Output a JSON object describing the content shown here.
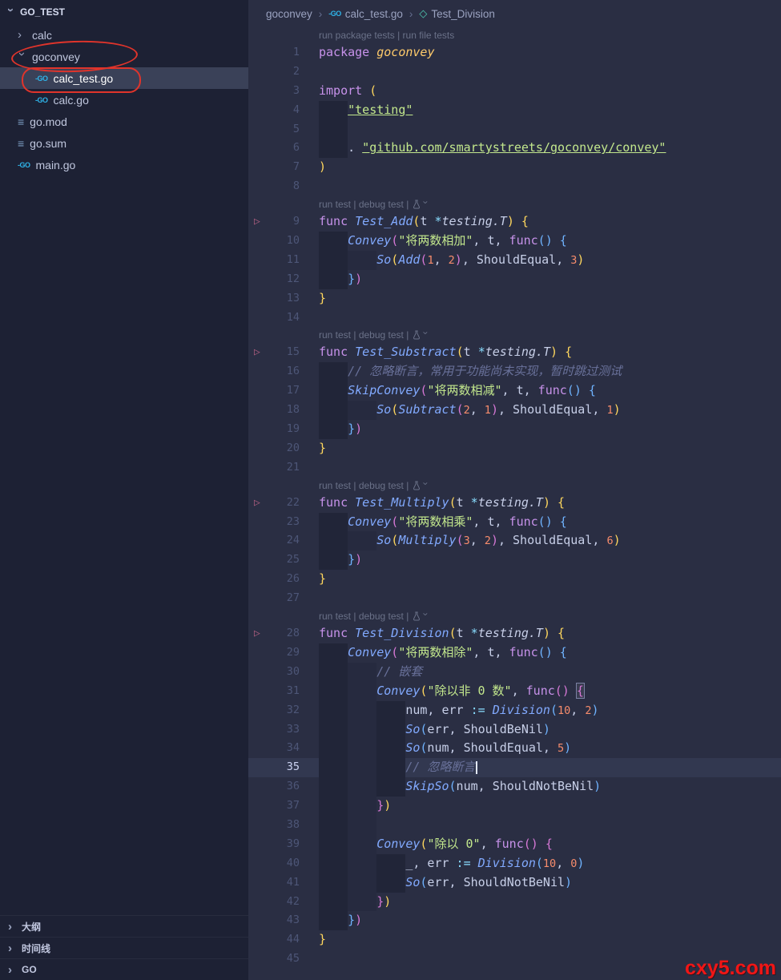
{
  "colors": {
    "annotation_red": "#e0342b",
    "watermark_red": "#f01616"
  },
  "glyphs": {
    "chevron": "›",
    "run": "▷",
    "go_file": "-GO",
    "module_file": "≡",
    "symbol": "◇"
  },
  "watermark": "cxy5.com",
  "sidebar": {
    "root": "GO_TEST",
    "items": [
      {
        "label": "calc",
        "kind": "folder",
        "state": "collapsed",
        "indent": 1
      },
      {
        "label": "goconvey",
        "kind": "folder",
        "state": "expanded",
        "indent": 1,
        "annotated": true
      },
      {
        "label": "calc_test.go",
        "kind": "file",
        "icon": "go",
        "indent": 2,
        "selected": true,
        "annotated": true
      },
      {
        "label": "calc.go",
        "kind": "file",
        "icon": "go",
        "indent": 2
      },
      {
        "label": "go.mod",
        "kind": "file",
        "icon": "mod",
        "indent": 1
      },
      {
        "label": "go.sum",
        "kind": "file",
        "icon": "mod",
        "indent": 1
      },
      {
        "label": "main.go",
        "kind": "file",
        "icon": "go",
        "indent": 1
      }
    ],
    "panels": [
      "大纲",
      "时间线",
      "GO"
    ]
  },
  "breadcrumb": {
    "separator": "›",
    "items": [
      {
        "label": "goconvey"
      },
      {
        "label": "calc_test.go",
        "icon": "go"
      },
      {
        "label": "Test_Division",
        "icon": "symbol-method"
      }
    ]
  },
  "codelens": {
    "top": {
      "links": [
        "run package tests",
        "run file tests"
      ],
      "separator": " | ",
      "has_icon": false
    },
    "test": {
      "links": [
        "run test",
        "debug test"
      ],
      "separator": " | ",
      "has_icon": true
    }
  },
  "editor": {
    "rows": [
      {
        "lens": "top"
      },
      {
        "n": 1,
        "ind": 0,
        "tok": [
          [
            "kw",
            "package "
          ],
          [
            "pkg",
            "goconvey"
          ]
        ]
      },
      {
        "n": 2,
        "ind": 0,
        "tok": []
      },
      {
        "n": 3,
        "ind": 0,
        "tok": [
          [
            "kw",
            "import "
          ],
          [
            "b1",
            "("
          ]
        ]
      },
      {
        "n": 4,
        "ind": 1,
        "tok": [
          [
            "lnk",
            "\"testing\""
          ]
        ]
      },
      {
        "n": 5,
        "ind": 1,
        "tok": []
      },
      {
        "n": 6,
        "ind": 1,
        "tok": [
          [
            "pln",
            ". "
          ],
          [
            "lnk",
            "\"github.com/smartystreets/goconvey/convey\""
          ]
        ]
      },
      {
        "n": 7,
        "ind": 0,
        "tok": [
          [
            "b1",
            ")"
          ]
        ]
      },
      {
        "n": 8,
        "ind": 0,
        "tok": []
      },
      {
        "lens": "test"
      },
      {
        "n": 9,
        "run": true,
        "ind": 0,
        "tok": [
          [
            "kw",
            "func "
          ],
          [
            "fn",
            "Test_Add"
          ],
          [
            "b1",
            "("
          ],
          [
            "pln",
            "t "
          ],
          [
            "op",
            "*"
          ],
          [
            "typ",
            "testing.T"
          ],
          [
            "b1",
            ")"
          ],
          [
            "pln",
            " "
          ],
          [
            "b1",
            "{"
          ]
        ]
      },
      {
        "n": 10,
        "ind": 1,
        "tok": [
          [
            "fn",
            "Convey"
          ],
          [
            "b2",
            "("
          ],
          [
            "str",
            "\"将两数相加\""
          ],
          [
            "pln",
            ", t, "
          ],
          [
            "kw",
            "func"
          ],
          [
            "b3",
            "()"
          ],
          [
            "pln",
            " "
          ],
          [
            "b3",
            "{"
          ]
        ]
      },
      {
        "n": 11,
        "ind": 2,
        "tok": [
          [
            "fn",
            "So"
          ],
          [
            "b1",
            "("
          ],
          [
            "fn",
            "Add"
          ],
          [
            "b2",
            "("
          ],
          [
            "num",
            "1"
          ],
          [
            "pln",
            ", "
          ],
          [
            "num",
            "2"
          ],
          [
            "b2",
            ")"
          ],
          [
            "pln",
            ", ShouldEqual, "
          ],
          [
            "num",
            "3"
          ],
          [
            "b1",
            ")"
          ]
        ]
      },
      {
        "n": 12,
        "ind": 1,
        "tok": [
          [
            "b3",
            "}"
          ],
          [
            "b2",
            ")"
          ]
        ]
      },
      {
        "n": 13,
        "ind": 0,
        "tok": [
          [
            "b1",
            "}"
          ]
        ]
      },
      {
        "n": 14,
        "ind": 0,
        "tok": []
      },
      {
        "lens": "test"
      },
      {
        "n": 15,
        "run": true,
        "ind": 0,
        "tok": [
          [
            "kw",
            "func "
          ],
          [
            "fn",
            "Test_Substract"
          ],
          [
            "b1",
            "("
          ],
          [
            "pln",
            "t "
          ],
          [
            "op",
            "*"
          ],
          [
            "typ",
            "testing.T"
          ],
          [
            "b1",
            ")"
          ],
          [
            "pln",
            " "
          ],
          [
            "b1",
            "{"
          ]
        ]
      },
      {
        "n": 16,
        "ind": 1,
        "tok": [
          [
            "cmt",
            "// 忽略断言，常用于功能尚未实现，暂时跳过测试"
          ]
        ]
      },
      {
        "n": 17,
        "ind": 1,
        "tok": [
          [
            "fn",
            "SkipConvey"
          ],
          [
            "b2",
            "("
          ],
          [
            "str",
            "\"将两数相减\""
          ],
          [
            "pln",
            ", t, "
          ],
          [
            "kw",
            "func"
          ],
          [
            "b3",
            "()"
          ],
          [
            "pln",
            " "
          ],
          [
            "b3",
            "{"
          ]
        ]
      },
      {
        "n": 18,
        "ind": 2,
        "tok": [
          [
            "fn",
            "So"
          ],
          [
            "b1",
            "("
          ],
          [
            "fn",
            "Subtract"
          ],
          [
            "b2",
            "("
          ],
          [
            "num",
            "2"
          ],
          [
            "pln",
            ", "
          ],
          [
            "num",
            "1"
          ],
          [
            "b2",
            ")"
          ],
          [
            "pln",
            ", ShouldEqual, "
          ],
          [
            "num",
            "1"
          ],
          [
            "b1",
            ")"
          ]
        ]
      },
      {
        "n": 19,
        "ind": 1,
        "tok": [
          [
            "b3",
            "}"
          ],
          [
            "b2",
            ")"
          ]
        ]
      },
      {
        "n": 20,
        "ind": 0,
        "tok": [
          [
            "b1",
            "}"
          ]
        ]
      },
      {
        "n": 21,
        "ind": 0,
        "tok": []
      },
      {
        "lens": "test"
      },
      {
        "n": 22,
        "run": true,
        "ind": 0,
        "tok": [
          [
            "kw",
            "func "
          ],
          [
            "fn",
            "Test_Multiply"
          ],
          [
            "b1",
            "("
          ],
          [
            "pln",
            "t "
          ],
          [
            "op",
            "*"
          ],
          [
            "typ",
            "testing.T"
          ],
          [
            "b1",
            ")"
          ],
          [
            "pln",
            " "
          ],
          [
            "b1",
            "{"
          ]
        ]
      },
      {
        "n": 23,
        "ind": 1,
        "tok": [
          [
            "fn",
            "Convey"
          ],
          [
            "b2",
            "("
          ],
          [
            "str",
            "\"将两数相乘\""
          ],
          [
            "pln",
            ", t, "
          ],
          [
            "kw",
            "func"
          ],
          [
            "b3",
            "()"
          ],
          [
            "pln",
            " "
          ],
          [
            "b3",
            "{"
          ]
        ]
      },
      {
        "n": 24,
        "ind": 2,
        "tok": [
          [
            "fn",
            "So"
          ],
          [
            "b1",
            "("
          ],
          [
            "fn",
            "Multiply"
          ],
          [
            "b2",
            "("
          ],
          [
            "num",
            "3"
          ],
          [
            "pln",
            ", "
          ],
          [
            "num",
            "2"
          ],
          [
            "b2",
            ")"
          ],
          [
            "pln",
            ", ShouldEqual, "
          ],
          [
            "num",
            "6"
          ],
          [
            "b1",
            ")"
          ]
        ]
      },
      {
        "n": 25,
        "ind": 1,
        "tok": [
          [
            "b3",
            "}"
          ],
          [
            "b2",
            ")"
          ]
        ]
      },
      {
        "n": 26,
        "ind": 0,
        "tok": [
          [
            "b1",
            "}"
          ]
        ]
      },
      {
        "n": 27,
        "ind": 0,
        "tok": []
      },
      {
        "lens": "test"
      },
      {
        "n": 28,
        "run": true,
        "ind": 0,
        "tok": [
          [
            "kw",
            "func "
          ],
          [
            "fn",
            "Test_Division"
          ],
          [
            "b1",
            "("
          ],
          [
            "pln",
            "t "
          ],
          [
            "op",
            "*"
          ],
          [
            "typ",
            "testing.T"
          ],
          [
            "b1",
            ")"
          ],
          [
            "pln",
            " "
          ],
          [
            "b1",
            "{"
          ]
        ]
      },
      {
        "n": 29,
        "ind": 1,
        "tok": [
          [
            "fn",
            "Convey"
          ],
          [
            "b2",
            "("
          ],
          [
            "str",
            "\"将两数相除\""
          ],
          [
            "pln",
            ", t, "
          ],
          [
            "kw",
            "func"
          ],
          [
            "b3",
            "()"
          ],
          [
            "pln",
            " "
          ],
          [
            "b3",
            "{"
          ]
        ]
      },
      {
        "n": 30,
        "ind": 2,
        "tok": [
          [
            "cmt",
            "// 嵌套"
          ]
        ]
      },
      {
        "n": 31,
        "ind": 2,
        "tok": [
          [
            "fn",
            "Convey"
          ],
          [
            "b1",
            "("
          ],
          [
            "str",
            "\"除以非 0 数\""
          ],
          [
            "pln",
            ", "
          ],
          [
            "kw",
            "func"
          ],
          [
            "b2",
            "()"
          ],
          [
            "pln",
            " "
          ],
          [
            "b2m",
            "{"
          ]
        ]
      },
      {
        "n": 32,
        "ind": 3,
        "tok": [
          [
            "pln",
            "num, err "
          ],
          [
            "op",
            ":="
          ],
          [
            "pln",
            " "
          ],
          [
            "fn",
            "Division"
          ],
          [
            "b3",
            "("
          ],
          [
            "num",
            "10"
          ],
          [
            "pln",
            ", "
          ],
          [
            "num",
            "2"
          ],
          [
            "b3",
            ")"
          ]
        ]
      },
      {
        "n": 33,
        "ind": 3,
        "tok": [
          [
            "fn",
            "So"
          ],
          [
            "b3",
            "("
          ],
          [
            "pln",
            "err, ShouldBeNil"
          ],
          [
            "b3",
            ")"
          ]
        ]
      },
      {
        "n": 34,
        "ind": 3,
        "tok": [
          [
            "fn",
            "So"
          ],
          [
            "b3",
            "("
          ],
          [
            "pln",
            "num, ShouldEqual, "
          ],
          [
            "num",
            "5"
          ],
          [
            "b3",
            ")"
          ]
        ]
      },
      {
        "n": 35,
        "ind": 3,
        "cur": true,
        "cursor": true,
        "tok": [
          [
            "cmt",
            "// 忽略断言"
          ]
        ]
      },
      {
        "n": 36,
        "ind": 3,
        "tok": [
          [
            "fn",
            "SkipSo"
          ],
          [
            "b3",
            "("
          ],
          [
            "pln",
            "num, ShouldNotBeNil"
          ],
          [
            "b3",
            ")"
          ]
        ]
      },
      {
        "n": 37,
        "ind": 2,
        "tok": [
          [
            "b2",
            "}"
          ],
          [
            "b1",
            ")"
          ]
        ]
      },
      {
        "n": 38,
        "ind": 2,
        "tok": []
      },
      {
        "n": 39,
        "ind": 2,
        "tok": [
          [
            "fn",
            "Convey"
          ],
          [
            "b1",
            "("
          ],
          [
            "str",
            "\"除以 0\""
          ],
          [
            "pln",
            ", "
          ],
          [
            "kw",
            "func"
          ],
          [
            "b2",
            "()"
          ],
          [
            "pln",
            " "
          ],
          [
            "b2",
            "{"
          ]
        ]
      },
      {
        "n": 40,
        "ind": 3,
        "tok": [
          [
            "pln",
            "_, err "
          ],
          [
            "op",
            ":="
          ],
          [
            "pln",
            " "
          ],
          [
            "fn",
            "Division"
          ],
          [
            "b3",
            "("
          ],
          [
            "num",
            "10"
          ],
          [
            "pln",
            ", "
          ],
          [
            "num",
            "0"
          ],
          [
            "b3",
            ")"
          ]
        ]
      },
      {
        "n": 41,
        "ind": 3,
        "tok": [
          [
            "fn",
            "So"
          ],
          [
            "b3",
            "("
          ],
          [
            "pln",
            "err, ShouldNotBeNil"
          ],
          [
            "b3",
            ")"
          ]
        ]
      },
      {
        "n": 42,
        "ind": 2,
        "tok": [
          [
            "b2",
            "}"
          ],
          [
            "b1",
            ")"
          ]
        ]
      },
      {
        "n": 43,
        "ind": 1,
        "tok": [
          [
            "b3",
            "}"
          ],
          [
            "b2",
            ")"
          ]
        ]
      },
      {
        "n": 44,
        "ind": 0,
        "tok": [
          [
            "b1",
            "}"
          ]
        ]
      },
      {
        "n": 45,
        "ind": 0,
        "tok": []
      }
    ]
  }
}
